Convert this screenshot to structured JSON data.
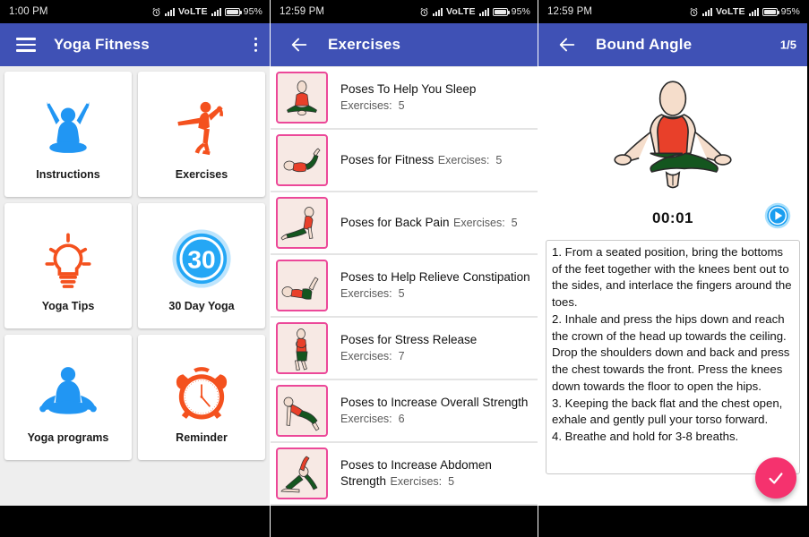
{
  "statusbar": {
    "time_panel1": "1:00 PM",
    "time_panel2": "12:59 PM",
    "time_panel3": "12:59 PM",
    "network_label": "VoLTE",
    "battery_percent": "95%",
    "alarm_icon": "alarm-clock-icon",
    "signal_icon": "signal-bars-icon",
    "battery_icon": "battery-icon"
  },
  "panel1": {
    "appbar": {
      "title": "Yoga Fitness",
      "menu_icon": "hamburger-menu-icon",
      "overflow_icon": "overflow-menu-icon"
    },
    "tiles": [
      {
        "label": "Instructions",
        "icon": "yoga-arms-up-icon",
        "color": "#2196f3"
      },
      {
        "label": "Exercises",
        "icon": "yoga-dancer-pose-icon",
        "color": "#f4511e"
      },
      {
        "label": "Yoga Tips",
        "icon": "lightbulb-icon",
        "color": "#f4511e"
      },
      {
        "label": "30 Day Yoga",
        "icon": "thirty-day-badge-icon",
        "color": "#25a7f5",
        "badge_text": "30"
      },
      {
        "label": "Yoga programs",
        "icon": "lotus-meditation-icon",
        "color": "#2196f3"
      },
      {
        "label": "Reminder",
        "icon": "alarm-clock-icon",
        "color": "#f4511e"
      }
    ]
  },
  "panel2": {
    "appbar": {
      "title": "Exercises",
      "back_icon": "back-arrow-icon"
    },
    "exercise_count_label": "Exercises:",
    "items": [
      {
        "title": "Poses To Help You Sleep",
        "count": "5",
        "thumb": "seated-lotus-pose-thumb"
      },
      {
        "title": "Poses for Fitness",
        "count": "5",
        "thumb": "supine-leg-raise-pose-thumb"
      },
      {
        "title": "Poses for Back Pain",
        "count": "5",
        "thumb": "cobra-pose-thumb"
      },
      {
        "title": "Poses to Help Relieve Constipation",
        "count": "5",
        "thumb": "knee-to-chest-pose-thumb"
      },
      {
        "title": "Poses for Stress Release",
        "count": "7",
        "thumb": "standing-twist-pose-thumb"
      },
      {
        "title": "Poses to Increase Overall Strength",
        "count": "6",
        "thumb": "plank-pose-thumb"
      },
      {
        "title": "Poses to Increase Abdomen Strength",
        "count": "5",
        "thumb": "side-stretch-pose-thumb"
      }
    ]
  },
  "panel3": {
    "appbar": {
      "title": "Bound Angle",
      "back_icon": "back-arrow-icon",
      "counter": "1/5"
    },
    "pose_image": "bound-angle-pose-illustration",
    "timer": "00:01",
    "play_icon": "play-button-icon",
    "confirm_icon": "checkmark-icon",
    "instructions": "1. From a seated position, bring the bottoms of the feet together with the knees bent out to the sides, and interlace the fingers around the toes.\n2. Inhale and press the hips down and reach the crown of the head up towards the ceiling. Drop the shoulders down and back and press the chest towards the front. Press the knees down towards the floor to open the hips.\n3. Keeping the back flat and the chest open, exhale and gently pull your torso forward.\n4. Breathe and hold for 3-8 breaths."
  },
  "theme": {
    "appbar_blue": "#3f51b5",
    "accent_pink": "#ec4899",
    "fab_pink": "#f5326e",
    "icon_blue": "#2196f3",
    "icon_orange": "#f4511e"
  }
}
